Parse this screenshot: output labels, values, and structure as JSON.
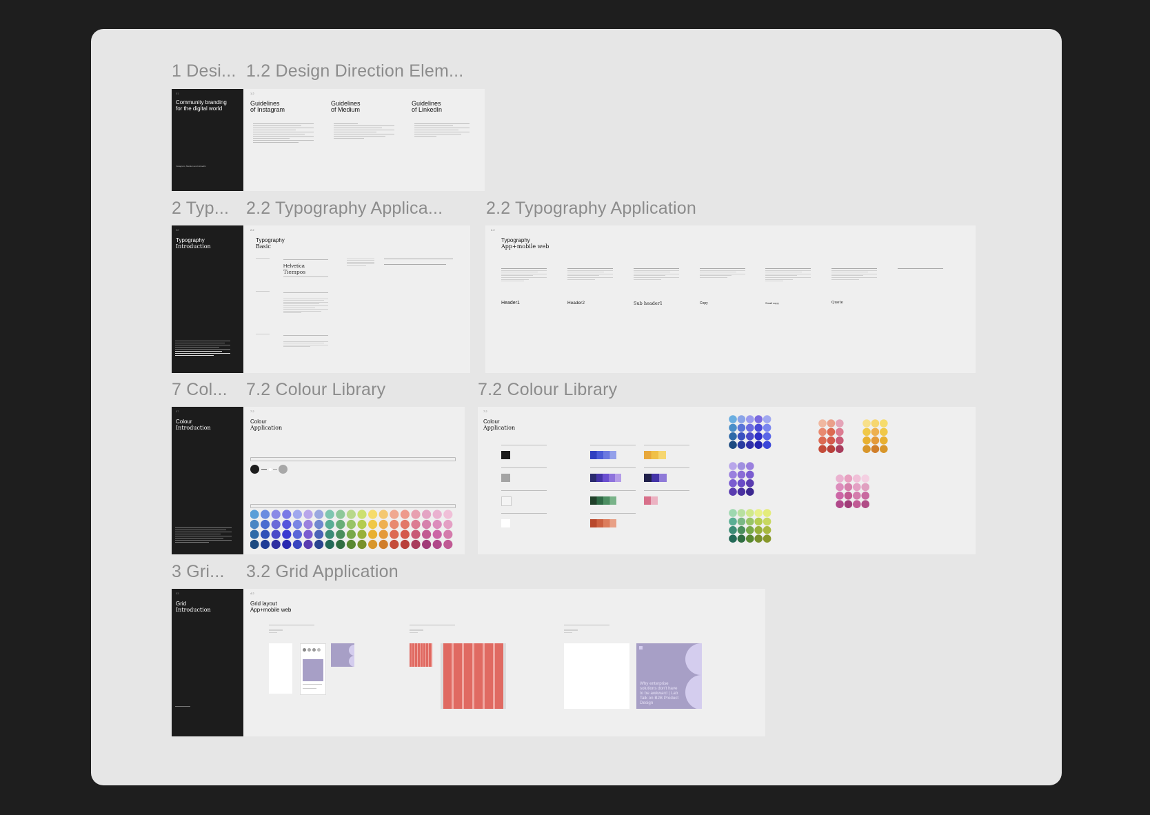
{
  "rows": [
    {
      "labels": {
        "intro": "1 Desi...",
        "app": "1.2 Design Direction Elem..."
      },
      "intro": {
        "page_num": "01",
        "title_line1": "Community branding",
        "title_line2": "for the digital world",
        "footer": "Instagram, Medium and LinkedIn"
      },
      "app": {
        "page_num": "1.2",
        "cols": [
          {
            "line1": "Guidelines",
            "line2": "of Instagram"
          },
          {
            "line1": "Guidelines",
            "line2": "of Medium"
          },
          {
            "line1": "Guidelines",
            "line2": "of LinkedIn"
          }
        ]
      }
    },
    {
      "labels": {
        "intro": "2 Typ...",
        "app": "2.2 Typography Applica...",
        "app2": "2.2 Typography Application"
      },
      "intro": {
        "page_num": "02",
        "title_line1": "Typography",
        "title_line2": "Introduction"
      },
      "app": {
        "page_num": "2.2",
        "title_line1": "Typography",
        "title_line2": "Basic",
        "font1": "Helvetica",
        "font2": "Tiempos"
      },
      "app2": {
        "page_num": "2.2",
        "title_line1": "Typography",
        "title_line2": "App+mobile web",
        "samples": [
          "Header1",
          "Header2",
          "Sub header1",
          "Copy",
          "Small copy",
          "Quote"
        ]
      }
    },
    {
      "labels": {
        "intro": "7 Col...",
        "app": "7.2 Colour Library",
        "app2": "7.2 Colour Library"
      },
      "intro": {
        "page_num": "07",
        "title_line1": "Colour",
        "title_line2": "Introduction"
      },
      "app": {
        "page_num": "7.2",
        "title_line1": "Colour",
        "title_line2": "Application"
      },
      "app2": {
        "page_num": "7.2",
        "title_line1": "Colour",
        "title_line2": "Application"
      }
    },
    {
      "labels": {
        "intro": "3 Gri...",
        "app": "3.2 Grid Application"
      },
      "intro": {
        "page_num": "03",
        "title_line1": "Grid",
        "title_line2": "Introduction"
      },
      "app": {
        "page_num": "4.2",
        "title_line1": "Grid layout",
        "title_line2": "App+mobile web",
        "card_text": "Why enterprise solutions don't have to be awkward | Lab Talk on B2B Product Design"
      }
    }
  ],
  "colors": {
    "app_bg": "#1e1e1e",
    "canvas_bg": "#e6e6e6",
    "frame_dark": "#1c1c1c",
    "frame_light": "#efefef",
    "label_gray": "#8c8c8c",
    "grid_red": "#e06a62",
    "card_purple": "#a79fc6"
  }
}
